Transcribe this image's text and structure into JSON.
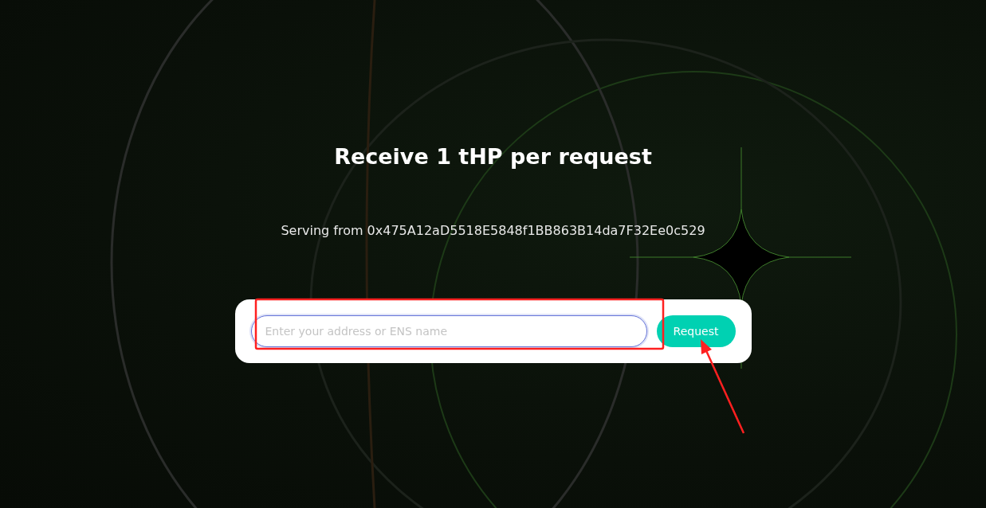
{
  "heading": "Receive 1 tHP per request",
  "serving_text": "Serving from 0x475A12aD5518E5848f1BB863B14da7F32Ee0c529",
  "address_field": {
    "placeholder": "Enter your address or ENS name"
  },
  "request_button": {
    "label": "Request"
  }
}
